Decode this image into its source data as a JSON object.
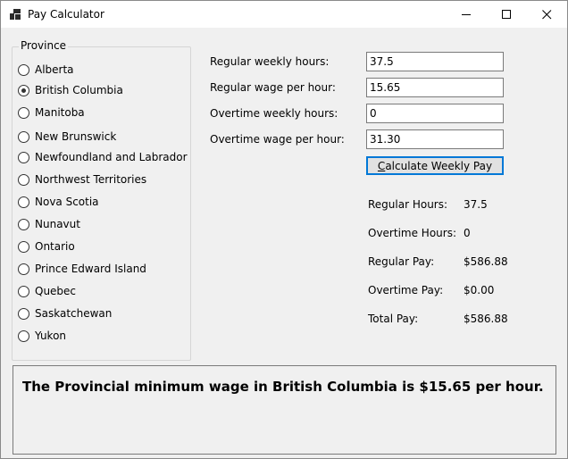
{
  "window": {
    "title": "Pay Calculator"
  },
  "province_group": {
    "legend": "Province",
    "selected_index": 1,
    "options": [
      "Alberta",
      "British Columbia",
      "Manitoba",
      "New Brunswick",
      "Newfoundland and Labrador",
      "Northwest Territories",
      "Nova Scotia",
      "Nunavut",
      "Ontario",
      "Prince Edward Island",
      "Quebec",
      "Saskatchewan",
      "Yukon"
    ]
  },
  "inputs": {
    "regular_hours_label": "Regular weekly hours:",
    "regular_hours_value": "37.5",
    "regular_wage_label": "Regular wage per hour:",
    "regular_wage_value": "15.65",
    "overtime_hours_label": "Overtime weekly hours:",
    "overtime_hours_value": "0",
    "overtime_wage_label": "Overtime wage per hour:",
    "overtime_wage_value": "31.30"
  },
  "calculate_button": {
    "accelerator": "C",
    "rest": "alculate Weekly Pay"
  },
  "results": {
    "regular_hours_label": "Regular Hours:",
    "regular_hours_value": "37.5",
    "overtime_hours_label": "Overtime Hours:",
    "overtime_hours_value": "0",
    "regular_pay_label": "Regular Pay:",
    "regular_pay_value": "$586.88",
    "overtime_pay_label": "Overtime Pay:",
    "overtime_pay_value": "$0.00",
    "total_pay_label": "Total Pay:",
    "total_pay_value": "$586.88"
  },
  "message": "The Provincial minimum wage in British Columbia is $15.65 per hour."
}
